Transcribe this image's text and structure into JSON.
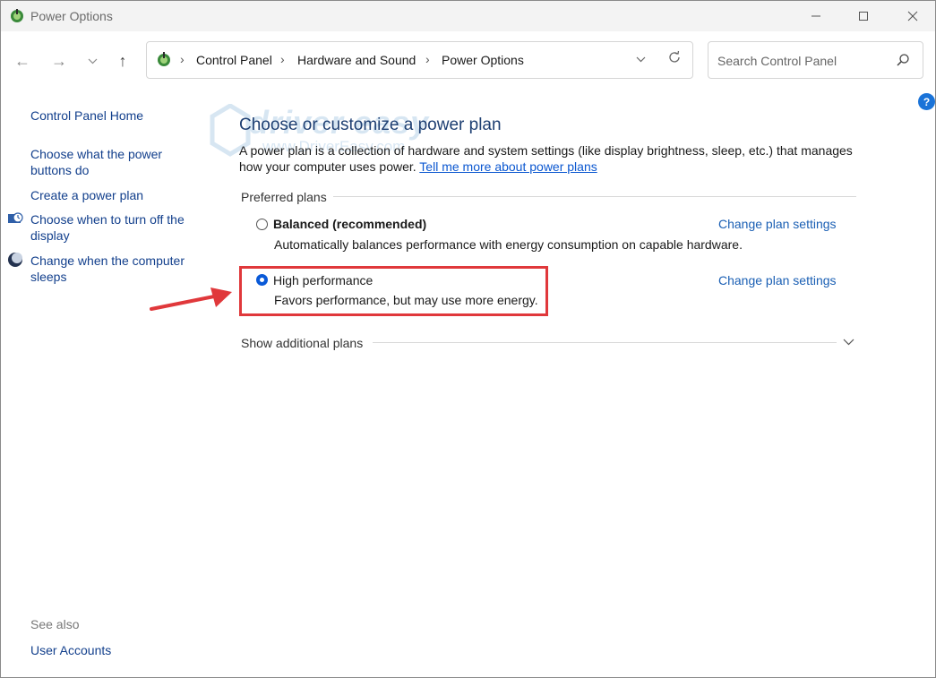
{
  "window": {
    "title": "Power Options",
    "controls": {
      "minimize_icon": "minimize-icon",
      "maximize_icon": "maximize-icon",
      "close_icon": "close-icon"
    }
  },
  "address": {
    "breadcrumbs": [
      "Control Panel",
      "Hardware and Sound",
      "Power Options"
    ],
    "search_placeholder": "Search Control Panel"
  },
  "sidebar": {
    "home": "Control Panel Home",
    "links": [
      {
        "label": "Choose what the power buttons do",
        "icon": ""
      },
      {
        "label": "Create a power plan",
        "icon": ""
      },
      {
        "label": "Choose when to turn off the display",
        "icon": "display-clock-icon"
      },
      {
        "label": "Change when the computer sleeps",
        "icon": "moon-icon"
      }
    ],
    "see_also_label": "See also",
    "see_also_links": [
      "User Accounts"
    ]
  },
  "main": {
    "title": "Choose or customize a power plan",
    "description": "A power plan is a collection of hardware and system settings (like display brightness, sleep, etc.) that manages how your computer uses power.",
    "learn_more": "Tell me more about power plans",
    "preferred_label": "Preferred plans",
    "plans": [
      {
        "name": "Balanced (recommended)",
        "description": "Automatically balances performance with energy consumption on capable hardware.",
        "selected": false,
        "change_link": "Change plan settings"
      },
      {
        "name": "High performance",
        "description": "Favors performance, but may use more energy.",
        "selected": true,
        "change_link": "Change plan settings"
      }
    ],
    "show_additional": "Show additional plans"
  },
  "watermark": {
    "text": "driver easy",
    "url": "www.DriverEasy.com"
  },
  "colors": {
    "highlight_box": "#e0383b",
    "arrow": "#e0383b",
    "link": "#1a5fb4",
    "selected_radio": "#0a5ad8"
  }
}
